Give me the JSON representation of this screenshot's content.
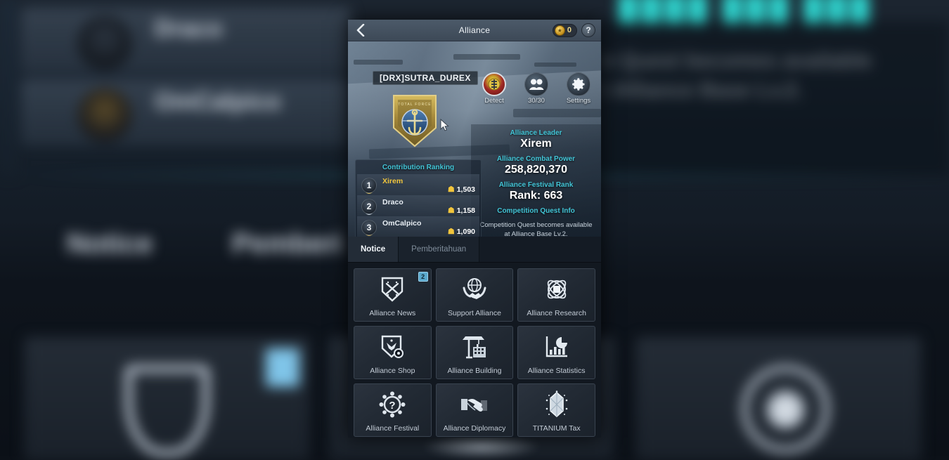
{
  "header": {
    "title": "Alliance",
    "back_icon": "back-chevron-icon",
    "currency": {
      "icon": "gold-coin-icon",
      "value": "0"
    },
    "help_label": "?"
  },
  "hero": {
    "alliance_tag_name": "[DRX]SUTRA_DUREX",
    "emblem_motto": "TOTAL  FORCE",
    "actions": [
      {
        "icon": "detect-radar-icon",
        "label": "Detect"
      },
      {
        "icon": "members-icon",
        "label": "30/30"
      },
      {
        "icon": "gear-icon",
        "label": "Settings"
      }
    ],
    "info": {
      "leader_label": "Alliance Leader",
      "leader_name": "Xirem",
      "combat_power_label": "Alliance Combat Power",
      "combat_power_value": "258,820,370",
      "festival_rank_label": "Alliance Festival Rank",
      "festival_rank_value": "Rank: 663",
      "quest_info_label": "Competition Quest Info",
      "quest_info_desc": "Competition Quest becomes available at Alliance Base Lv.2."
    },
    "ranking": {
      "title": "Contribution Ranking",
      "rows": [
        {
          "rank": "1",
          "name": "Xirem",
          "score": "1,503",
          "medal": "gold"
        },
        {
          "rank": "2",
          "name": "Draco",
          "score": "1,158",
          "medal": "silver"
        },
        {
          "rank": "3",
          "name": "OmCalpico",
          "score": "1,090",
          "medal": "bronze"
        }
      ]
    }
  },
  "tabs": [
    {
      "label": "Notice",
      "active": true
    },
    {
      "label": "Pemberitahuan",
      "active": false
    }
  ],
  "menu": [
    {
      "label": "Alliance News",
      "icon": "shield-crossed-swords-icon",
      "badge": "2"
    },
    {
      "label": "Support Alliance",
      "icon": "globe-handshake-icon",
      "badge": ""
    },
    {
      "label": "Alliance Research",
      "icon": "atom-icon",
      "badge": ""
    },
    {
      "label": "Alliance Shop",
      "icon": "shield-gear-icon",
      "badge": ""
    },
    {
      "label": "Alliance Building",
      "icon": "crane-building-icon",
      "badge": ""
    },
    {
      "label": "Alliance Statistics",
      "icon": "bar-chart-pie-icon",
      "badge": ""
    },
    {
      "label": "Alliance Festival",
      "icon": "gear-question-icon",
      "badge": ""
    },
    {
      "label": "Alliance Diplomacy",
      "icon": "handshake-icon",
      "badge": ""
    },
    {
      "label": "TITANIUM Tax",
      "icon": "titanium-crystal-icon",
      "badge": ""
    }
  ],
  "background": {
    "rows": [
      {
        "name": "Draco"
      },
      {
        "name": "OmCalpico"
      }
    ],
    "tabs": [
      "Notice",
      "Pemberi"
    ],
    "quest_text_line1": "n Quest becomes available",
    "quest_text_line2": "t Alliance Base Lv.2.",
    "colors": {
      "accent_teal": "#43c6d8",
      "gold": "#f0c53c",
      "badge_blue": "#5aa8cc",
      "panel_bg": "#121820"
    }
  }
}
